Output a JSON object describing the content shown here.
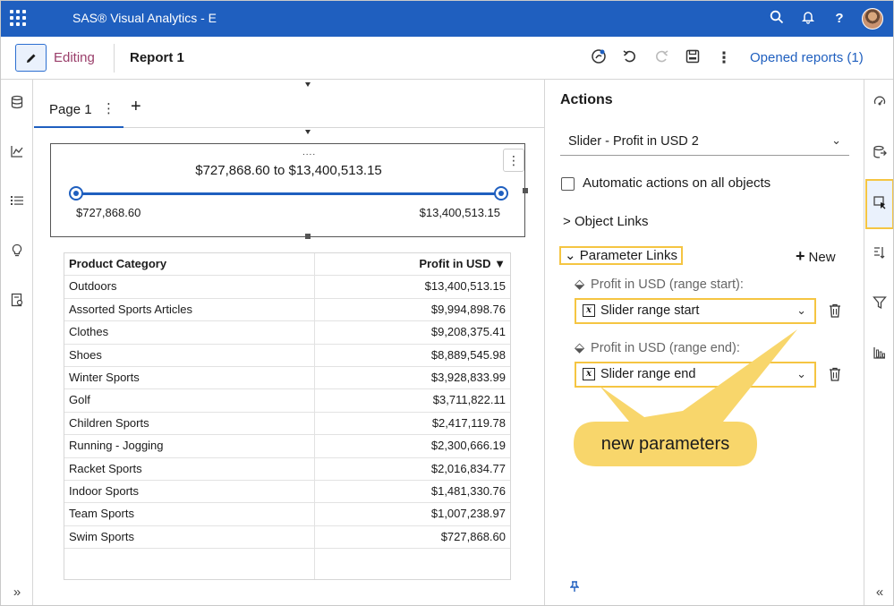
{
  "header": {
    "app_title": "SAS® Visual Analytics - E",
    "icons": [
      "apps-grid-icon",
      "search-icon",
      "bell-icon",
      "help-icon",
      "avatar"
    ],
    "help_glyph": "?"
  },
  "toolbar": {
    "edit_icon": "pencil-icon",
    "editing_label": "Editing",
    "report_title": "Report 1",
    "icons": [
      "ai-assist-icon",
      "undo-icon",
      "redo-icon",
      "save-icon",
      "more-icon"
    ],
    "opened_reports": "Opened reports (1)"
  },
  "left_rail": {
    "icons": [
      "data-icon",
      "objects-icon",
      "outline-icon",
      "suggestions-icon",
      "page-templates-icon"
    ],
    "expand": "»"
  },
  "canvas": {
    "tab_label": "Page 1",
    "add_tab": "+",
    "slider": {
      "drag_handle": "....",
      "range_text": "$727,868.60 to $13,400,513.15",
      "min_label": "$727,868.60",
      "max_label": "$13,400,513.15"
    },
    "table": {
      "headers": [
        "Product Category",
        "Profit in USD"
      ],
      "sort_indicator": "▼",
      "rows": [
        [
          "Outdoors",
          "$13,400,513.15"
        ],
        [
          "Assorted Sports Articles",
          "$9,994,898.76"
        ],
        [
          "Clothes",
          "$9,208,375.41"
        ],
        [
          "Shoes",
          "$8,889,545.98"
        ],
        [
          "Winter Sports",
          "$3,928,833.99"
        ],
        [
          "Golf",
          "$3,711,822.11"
        ],
        [
          "Children Sports",
          "$2,417,119.78"
        ],
        [
          "Running - Jogging",
          "$2,300,666.19"
        ],
        [
          "Racket Sports",
          "$2,016,834.77"
        ],
        [
          "Indoor Sports",
          "$1,481,330.76"
        ],
        [
          "Team Sports",
          "$1,007,238.97"
        ],
        [
          "Swim Sports",
          "$727,868.60"
        ]
      ]
    }
  },
  "actions_panel": {
    "title": "Actions",
    "object_select": "Slider - Profit in USD 2",
    "auto_actions_label": "Automatic actions on all objects",
    "object_links": "Object Links",
    "parameter_links": "Parameter Links",
    "new_button": "New",
    "params": [
      {
        "label": "Profit in USD (range start):",
        "value": "Slider range start"
      },
      {
        "label": "Profit in USD (range end):",
        "value": "Slider range end"
      }
    ],
    "callout": "new parameters"
  },
  "right_rail": {
    "icons": [
      "options-icon",
      "roles-icon",
      "actions-icon",
      "rules-icon",
      "filters-icon",
      "ranks-icon"
    ],
    "collapse": "«"
  },
  "colors": {
    "brand_blue": "#1f5fbf",
    "highlight_yellow": "#f5c542",
    "callout_fill": "#f8d66b"
  }
}
